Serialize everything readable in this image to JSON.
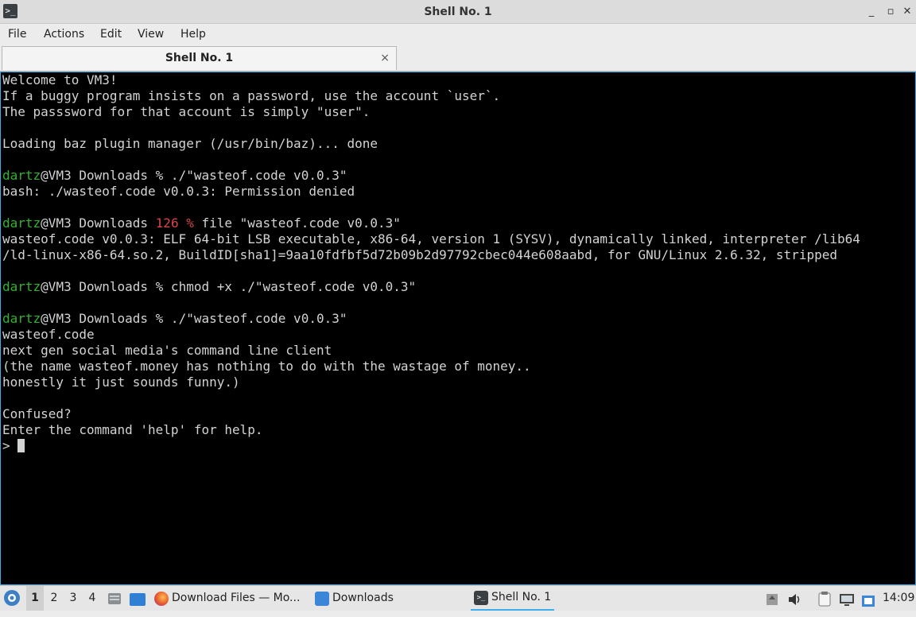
{
  "window": {
    "title": "Shell No. 1",
    "controls": [
      "_",
      "▫",
      "✕"
    ]
  },
  "menu": [
    "File",
    "Actions",
    "Edit",
    "View",
    "Help"
  ],
  "tab": {
    "title": "Shell No. 1",
    "close": "×"
  },
  "terminal": {
    "lines": [
      [
        {
          "t": "Welcome to VM3!"
        }
      ],
      [
        {
          "t": "If a buggy program insists on a password, use the account `user`."
        }
      ],
      [
        {
          "t": "The passsword for that account is simply \"user\"."
        }
      ],
      [],
      [
        {
          "t": "Loading baz plugin manager (/usr/bin/baz)... done"
        }
      ],
      [],
      [
        {
          "t": "dartz",
          "c": "green"
        },
        {
          "t": "@VM3 Downloads % ./\"wasteof.code v0.0.3\""
        }
      ],
      [
        {
          "t": "bash: ./wasteof.code v0.0.3: Permission denied"
        }
      ],
      [],
      [
        {
          "t": "dartz",
          "c": "green"
        },
        {
          "t": "@VM3 Downloads "
        },
        {
          "t": "126 %",
          "c": "red"
        },
        {
          "t": " file \"wasteof.code v0.0.3\""
        }
      ],
      [
        {
          "t": "wasteof.code v0.0.3: ELF 64-bit LSB executable, x86-64, version 1 (SYSV), dynamically linked, interpreter /lib64"
        }
      ],
      [
        {
          "t": "/ld-linux-x86-64.so.2, BuildID[sha1]=9aa10fdfbf5d72b09b2d97792cbec044e608aabd, for GNU/Linux 2.6.32, stripped"
        }
      ],
      [],
      [
        {
          "t": "dartz",
          "c": "green"
        },
        {
          "t": "@VM3 Downloads % chmod +x ./\"wasteof.code v0.0.3\""
        }
      ],
      [],
      [
        {
          "t": "dartz",
          "c": "green"
        },
        {
          "t": "@VM3 Downloads % ./\"wasteof.code v0.0.3\""
        }
      ],
      [
        {
          "t": "wasteof.code"
        }
      ],
      [
        {
          "t": "next gen social media's command line client"
        }
      ],
      [
        {
          "t": "(the name wasteof.money has nothing to do with the wastage of money.."
        }
      ],
      [
        {
          "t": "honestly it just sounds funny.)"
        }
      ],
      [],
      [
        {
          "t": "Confused?"
        }
      ],
      [
        {
          "t": "Enter the command 'help' for help."
        }
      ]
    ],
    "prompt": "> "
  },
  "taskbar": {
    "workspaces": [
      "1",
      "2",
      "3",
      "4"
    ],
    "active_workspace": "1",
    "tasks": [
      {
        "label": "Download Files — Mo...",
        "icon": "firefox-icon"
      },
      {
        "label": "Downloads",
        "icon": "folder-icon"
      },
      {
        "label": "Shell No. 1",
        "icon": "terminal-icon"
      }
    ],
    "clock": "14:09"
  },
  "colors": {
    "accent": "#3daee9",
    "prompt_user": "#2fb32f",
    "error_code": "#d94545",
    "terminal_bg": "#000000",
    "terminal_fg": "#d3d3d3"
  }
}
